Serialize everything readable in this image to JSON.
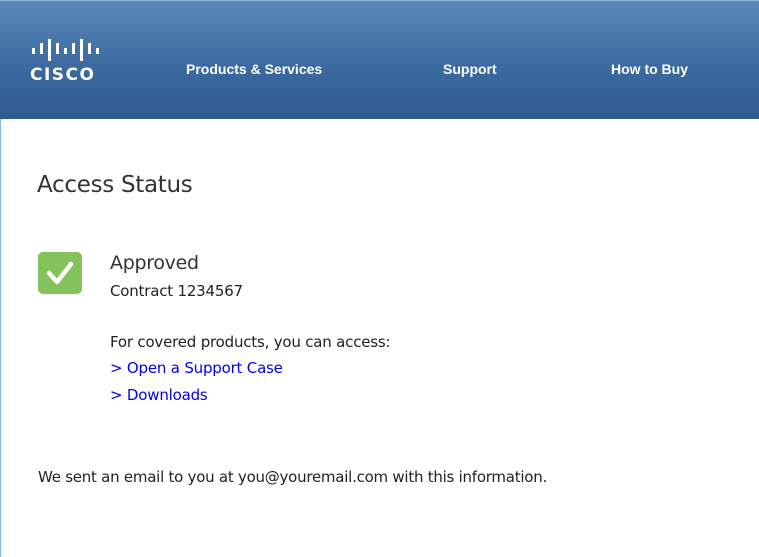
{
  "header": {
    "logo_text": "CISCO",
    "nav": [
      {
        "label": "Products & Services"
      },
      {
        "label": "Support"
      },
      {
        "label": "How to Buy"
      }
    ],
    "colors": {
      "bar_top": "#5b88b8",
      "bar_bottom": "#2f5a8f"
    }
  },
  "main": {
    "title": "Access Status",
    "status": {
      "icon": "checkmark-icon",
      "color": "#84c25b",
      "label": "Approved",
      "contract": "Contract 1234567"
    },
    "access_intro": "For covered products, you can access:",
    "links": [
      {
        "label": "> Open a Support Case"
      },
      {
        "label": "> Downloads"
      }
    ],
    "email_note": "We sent an email to you at you@youremail.com with this information."
  }
}
